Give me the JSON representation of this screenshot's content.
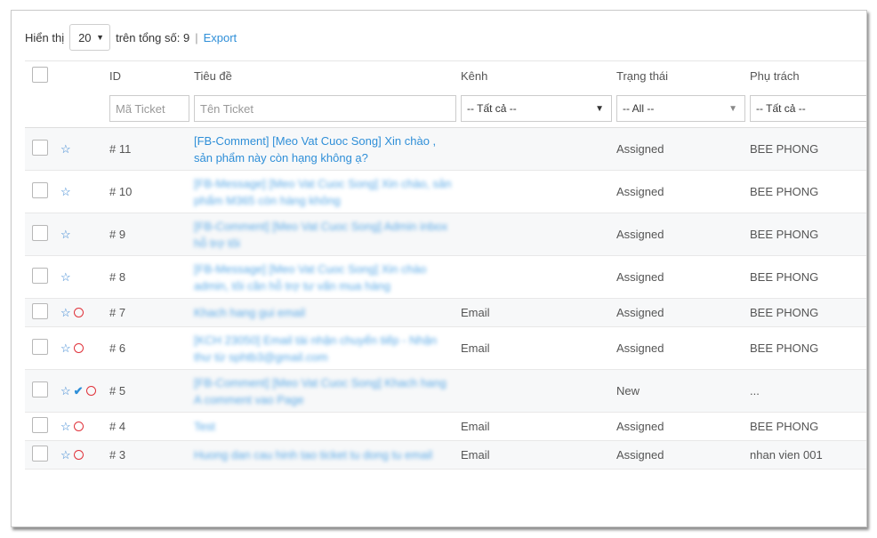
{
  "toolbar": {
    "show_label": "Hiển thị",
    "page_size": "20",
    "total_label": "trên tổng số: 9",
    "separator": "|",
    "export_label": "Export"
  },
  "table": {
    "headers": {
      "id": "ID",
      "title": "Tiêu đề",
      "channel": "Kênh",
      "status": "Trạng thái",
      "owner": "Phụ trách"
    },
    "filters": {
      "id_placeholder": "Mã Ticket",
      "title_placeholder": "Tên Ticket",
      "channel_value": "-- Tất cả --",
      "status_value": "-- All --",
      "owner_value": "-- Tất cả --"
    },
    "rows": [
      {
        "id": "# 11",
        "title": "[FB-Comment] [Meo Vat Cuoc Song] Xin chào , sản phẩm này còn hạng không ạ?",
        "channel": "",
        "status": "Assigned",
        "owner": "BEE PHONG",
        "icons": [
          "star"
        ],
        "blurred": false
      },
      {
        "id": "# 10",
        "title": "[FB-Message] [Meo Vat Cuoc Song] Xin chào, sản phẩm M365 còn hàng không",
        "channel": "",
        "status": "Assigned",
        "owner": "BEE PHONG",
        "icons": [
          "star"
        ],
        "blurred": true
      },
      {
        "id": "# 9",
        "title": "[FB-Comment] [Meo Vat Cuoc Song] Admin inbox hỗ trợ tôi",
        "channel": "",
        "status": "Assigned",
        "owner": "BEE PHONG",
        "icons": [
          "star"
        ],
        "blurred": true
      },
      {
        "id": "# 8",
        "title": "[FB-Message] [Meo Vat Cuoc Song] Xin chào admin, tôi cần hỗ trợ tư vấn mua hàng",
        "channel": "",
        "status": "Assigned",
        "owner": "BEE PHONG",
        "icons": [
          "star"
        ],
        "blurred": true
      },
      {
        "id": "# 7",
        "title": "Khach hang gui email",
        "channel": "Email",
        "status": "Assigned",
        "owner": "BEE PHONG",
        "icons": [
          "star",
          "circle"
        ],
        "blurred": true
      },
      {
        "id": "# 6",
        "title": "[KCH 23050] Email tài nhận chuyển tiếp - Nhận thư từ sphtb3@gmail.com",
        "channel": "Email",
        "status": "Assigned",
        "owner": "BEE PHONG",
        "icons": [
          "star",
          "circle"
        ],
        "blurred": true
      },
      {
        "id": "# 5",
        "title": "[FB-Comment] [Meo Vat Cuoc Song] Khach hang A comment vao Page",
        "channel": "",
        "status": "New",
        "owner": "...",
        "icons": [
          "star",
          "check",
          "circle"
        ],
        "blurred": true
      },
      {
        "id": "# 4",
        "title": "Test",
        "channel": "Email",
        "status": "Assigned",
        "owner": "BEE PHONG",
        "icons": [
          "star",
          "circle"
        ],
        "blurred": true
      },
      {
        "id": "# 3",
        "title": "Huong dan cau hinh tao ticket tu dong tu email",
        "channel": "Email",
        "status": "Assigned",
        "owner": "nhan vien 001",
        "icons": [
          "star",
          "circle"
        ],
        "blurred": true
      }
    ]
  },
  "colors": {
    "link": "#2f8fd8",
    "star": "#2f7fd0",
    "circle": "#e0323a",
    "row_alt": "#f7f8f9"
  }
}
